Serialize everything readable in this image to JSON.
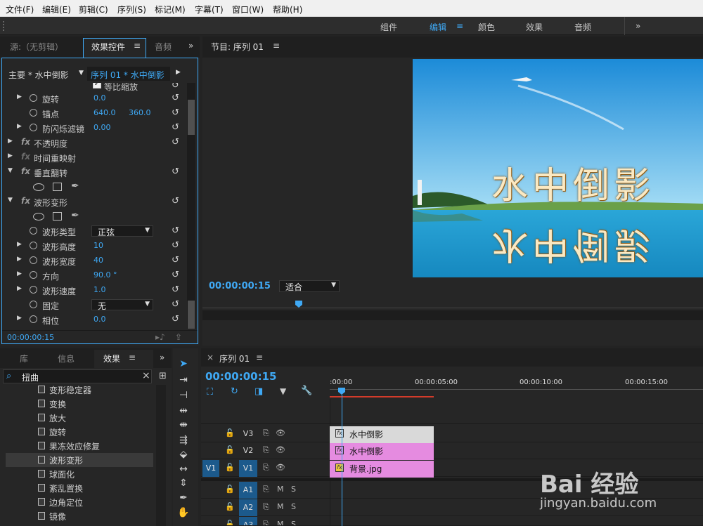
{
  "menu": [
    "文件(F)",
    "编辑(E)",
    "剪辑(C)",
    "序列(S)",
    "标记(M)",
    "字幕(T)",
    "窗口(W)",
    "帮助(H)"
  ],
  "workspace": {
    "tabs": [
      "组件",
      "编辑",
      "颜色",
      "效果",
      "音频"
    ],
    "active": "编辑",
    "more": "»"
  },
  "source_panel": {
    "tabs": [
      "源:（无剪辑）",
      "效果控件",
      "音频"
    ],
    "active_tab": "效果控件",
    "master_label": "主要 * 水中倒影",
    "sequence_label": "序列 01 * 水中倒影",
    "rows": [
      {
        "label": "等比缩放",
        "checked": true
      },
      {
        "label": "旋转",
        "v1": "0.0"
      },
      {
        "label": "锚点",
        "v1": "640.0",
        "v2": "360.0"
      },
      {
        "label": "防闪烁滤镜",
        "v1": "0.00"
      },
      {
        "label": "不透明度"
      },
      {
        "label": "时间重映射"
      },
      {
        "label": "垂直翻转"
      },
      {
        "label": "波形变形"
      },
      {
        "label": "波形类型",
        "dd": "正弦"
      },
      {
        "label": "波形高度",
        "v1": "10"
      },
      {
        "label": "波形宽度",
        "v1": "40"
      },
      {
        "label": "方向",
        "v1": "90.0 °"
      },
      {
        "label": "波形速度",
        "v1": "1.0"
      },
      {
        "label": "固定",
        "dd": "无"
      },
      {
        "label": "相位",
        "v1": "0.0"
      }
    ],
    "fx": "fx",
    "timecode": "00:00:00:15"
  },
  "program_panel": {
    "title": "节目: 序列 01",
    "image_text": "水中倒影",
    "timecode": "00:00:00:15",
    "fit": "适合"
  },
  "effects_panel": {
    "tabs": [
      "库",
      "信息",
      "效果"
    ],
    "active_tab": "效果",
    "search_value": "扭曲",
    "clear": "×",
    "items": [
      "变形稳定器",
      "变换",
      "放大",
      "旋转",
      "果冻效应修复",
      "波形变形",
      "球面化",
      "紊乱置换",
      "边角定位",
      "镜像"
    ],
    "selected": "波形变形"
  },
  "timeline": {
    "tab": "序列 01",
    "timecode": "00:00:00:15",
    "ruler": [
      ":00:00",
      "00:00:05:00",
      "00:00:10:00",
      "00:00:15:00"
    ],
    "tracks": [
      {
        "src": "",
        "name": "V3"
      },
      {
        "src": "",
        "name": "V2"
      },
      {
        "src": "V1",
        "name": "V1"
      },
      {
        "src": "",
        "name": "A1",
        "m": "M",
        "s": "S"
      },
      {
        "src": "",
        "name": "A2",
        "m": "M",
        "s": "S"
      },
      {
        "src": "",
        "name": "A3",
        "m": "M",
        "s": "S"
      }
    ],
    "clips": [
      {
        "label": "水中倒影",
        "color": "#d9d9d9"
      },
      {
        "label": "水中倒影",
        "color": "#e58be0"
      },
      {
        "label": "背景.jpg",
        "color": "#e58be0"
      }
    ]
  },
  "watermark": {
    "brand": "Bai 经验",
    "url": "jingyan.baidu.com"
  }
}
